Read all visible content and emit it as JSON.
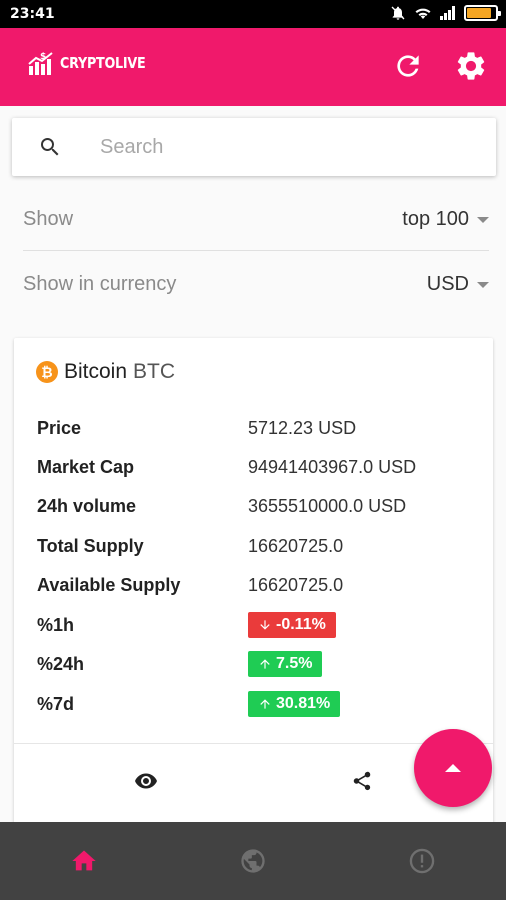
{
  "status_bar": {
    "time": "23:41"
  },
  "app_bar": {
    "logo_text": "CRYPTOLIVE",
    "refresh_icon": "refresh-icon",
    "settings_icon": "gear-icon",
    "color": "#f0196b"
  },
  "search": {
    "placeholder": "Search",
    "value": ""
  },
  "filters": {
    "show": {
      "label": "Show",
      "value": "top 100"
    },
    "currency": {
      "label": "Show in currency",
      "value": "USD"
    }
  },
  "coin": {
    "name": "Bitcoin",
    "symbol": "BTC",
    "logo_glyph": "₿",
    "stats": [
      {
        "label": "Price",
        "value": "5712.23 USD"
      },
      {
        "label": "Market Cap",
        "value": "94941403967.0 USD"
      },
      {
        "label": "24h volume",
        "value": "3655510000.0 USD"
      },
      {
        "label": "Total Supply",
        "value": "16620725.0"
      },
      {
        "label": "Available Supply",
        "value": "16620725.0"
      }
    ],
    "changes": [
      {
        "label": "%1h",
        "value": "-0.11%",
        "direction": "down",
        "color": "#ea3b3b"
      },
      {
        "label": "%24h",
        "value": "7.5%",
        "direction": "up",
        "color": "#1fcc54"
      },
      {
        "label": "%7d",
        "value": "30.81%",
        "direction": "up",
        "color": "#1fcc54"
      }
    ],
    "actions": [
      "eye-icon",
      "share-icon"
    ]
  },
  "fab": {
    "icon": "arrow-up-icon"
  },
  "bottom_nav": {
    "items": [
      {
        "icon": "home-icon",
        "active": true,
        "color": "#f0196b"
      },
      {
        "icon": "globe-icon",
        "active": false
      },
      {
        "icon": "info-icon",
        "active": false
      }
    ]
  }
}
